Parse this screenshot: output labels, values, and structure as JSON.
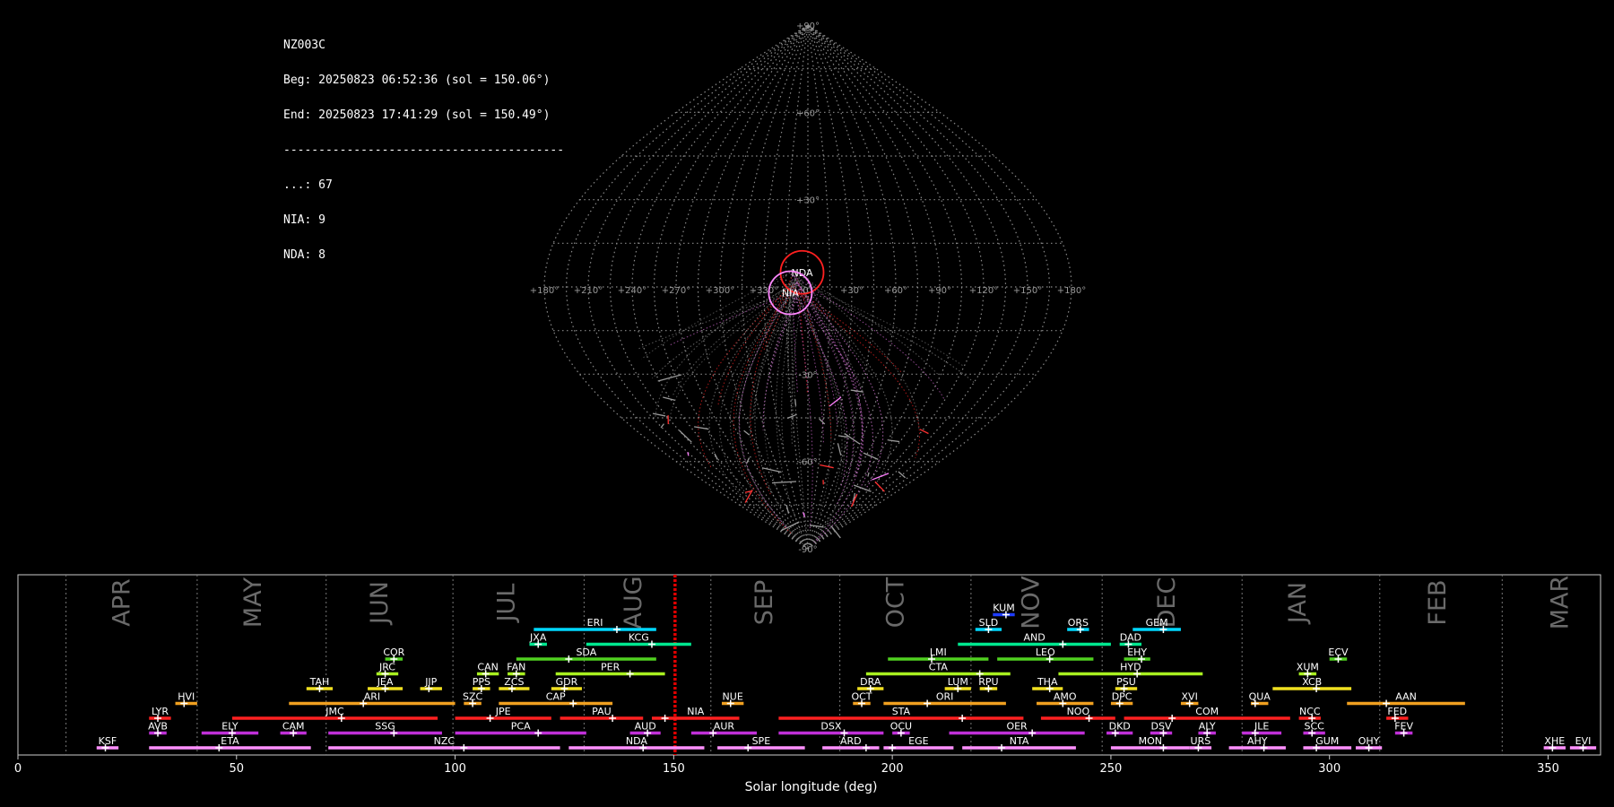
{
  "info": {
    "station": "NZ003C",
    "begin": "Beg: 20250823 06:52:36 (sol = 150.06°)",
    "end": "End: 20250823 17:41:29 (sol = 150.49°)",
    "separator": "----------------------------------------",
    "counts": [
      "...: 67",
      "NIA: 9",
      "NDA: 8"
    ]
  },
  "sky_map": {
    "projection": "sinusoidal",
    "lon_labels": [
      "+180°",
      "+150°",
      "+120°",
      "+90°",
      "+60°",
      "+30°",
      "0°",
      "+330°",
      "+300°",
      "+270°",
      "+240°",
      "+210°",
      "+180°"
    ],
    "lat_labels": [
      "+90°",
      "+60°",
      "+30°",
      "-30°",
      "-60°",
      "-90°"
    ],
    "radiants": [
      {
        "code": "NDA",
        "lon": -4,
        "lat": 5,
        "color": "#ff2020"
      },
      {
        "code": "NIA",
        "lon": -12,
        "lat": -2,
        "color": "#ff88ff"
      }
    ]
  },
  "chart_data": {
    "type": "bar",
    "xlabel": "Solar longitude (deg)",
    "xlim": [
      0,
      362
    ],
    "xticks": [
      0,
      50,
      100,
      150,
      200,
      250,
      300,
      350
    ],
    "current_sol": 150.3,
    "months": [
      {
        "name": "APR",
        "center": 24,
        "start": 11
      },
      {
        "name": "MAY",
        "center": 54,
        "start": 41
      },
      {
        "name": "JUN",
        "center": 83,
        "start": 70.5
      },
      {
        "name": "JUL",
        "center": 112,
        "start": 99.5
      },
      {
        "name": "AUG",
        "center": 141,
        "start": 129.5
      },
      {
        "name": "SEP",
        "center": 171,
        "start": 158.5
      },
      {
        "name": "OCT",
        "center": 201,
        "start": 188
      },
      {
        "name": "NOV",
        "center": 232,
        "start": 218
      },
      {
        "name": "DEC",
        "center": 263,
        "start": 248
      },
      {
        "name": "JAN",
        "center": 293,
        "start": 280
      },
      {
        "name": "FEB",
        "center": 325,
        "start": 311.5
      },
      {
        "name": "MAR",
        "center": 353,
        "start": 339.5
      }
    ],
    "showers": [
      {
        "code": "KUM",
        "start": 223,
        "end": 228,
        "peak": 226,
        "row": 9,
        "color": "#1e3cff"
      },
      {
        "code": "ERI",
        "start": 118,
        "end": 146,
        "peak": 137,
        "row": 8,
        "color": "#00d8ff"
      },
      {
        "code": "SLD",
        "start": 219,
        "end": 225,
        "peak": 222,
        "row": 8,
        "color": "#00d8ff"
      },
      {
        "code": "ORS",
        "start": 240,
        "end": 245,
        "peak": 243,
        "row": 8,
        "color": "#00d8ff"
      },
      {
        "code": "GEM",
        "start": 255,
        "end": 266,
        "peak": 262,
        "row": 8,
        "color": "#00d8ff"
      },
      {
        "code": "JXA",
        "start": 117,
        "end": 121,
        "peak": 119,
        "row": 7,
        "color": "#00e890"
      },
      {
        "code": "KCG",
        "start": 130,
        "end": 154,
        "peak": 145,
        "row": 7,
        "color": "#00e890"
      },
      {
        "code": "AND",
        "start": 215,
        "end": 250,
        "peak": 239,
        "row": 7,
        "color": "#00e890"
      },
      {
        "code": "DAD",
        "start": 252,
        "end": 257,
        "peak": 254,
        "row": 7,
        "color": "#00e890"
      },
      {
        "code": "COR",
        "start": 84,
        "end": 88,
        "peak": 86,
        "row": 6,
        "color": "#50d020"
      },
      {
        "code": "SDA",
        "start": 114,
        "end": 146,
        "peak": 126,
        "row": 6,
        "color": "#50d020"
      },
      {
        "code": "LMI",
        "start": 199,
        "end": 222,
        "peak": 209,
        "row": 6,
        "color": "#50d020"
      },
      {
        "code": "LEO",
        "start": 224,
        "end": 246,
        "peak": 236,
        "row": 6,
        "color": "#50d020"
      },
      {
        "code": "EHY",
        "start": 253,
        "end": 259,
        "peak": 257,
        "row": 6,
        "color": "#50d020"
      },
      {
        "code": "ECV",
        "start": 300,
        "end": 304,
        "peak": 302,
        "row": 6,
        "color": "#50d020"
      },
      {
        "code": "JRC",
        "start": 82,
        "end": 87,
        "peak": 84,
        "row": 5,
        "color": "#a8f020"
      },
      {
        "code": "CAN",
        "start": 105,
        "end": 110,
        "peak": 107,
        "row": 5,
        "color": "#a8f020"
      },
      {
        "code": "FAN",
        "start": 112,
        "end": 116,
        "peak": 114,
        "row": 5,
        "color": "#a8f020"
      },
      {
        "code": "PER",
        "start": 123,
        "end": 148,
        "peak": 140,
        "row": 5,
        "color": "#a8f020"
      },
      {
        "code": "CTA",
        "start": 194,
        "end": 227,
        "peak": 220,
        "row": 5,
        "color": "#a8f020"
      },
      {
        "code": "HYD",
        "start": 238,
        "end": 271,
        "peak": 256,
        "row": 5,
        "color": "#a8f020"
      },
      {
        "code": "XUM",
        "start": 293,
        "end": 297,
        "peak": 295,
        "row": 5,
        "color": "#a8f020"
      },
      {
        "code": "TAH",
        "start": 66,
        "end": 72,
        "peak": 69,
        "row": 4,
        "color": "#f0e020"
      },
      {
        "code": "JEA",
        "start": 80,
        "end": 88,
        "peak": 84,
        "row": 4,
        "color": "#f0e020"
      },
      {
        "code": "JIP",
        "start": 92,
        "end": 97,
        "peak": 94,
        "row": 4,
        "color": "#f0e020"
      },
      {
        "code": "PPS",
        "start": 104,
        "end": 108,
        "peak": 106,
        "row": 4,
        "color": "#f0e020"
      },
      {
        "code": "ZCS",
        "start": 110,
        "end": 117,
        "peak": 113,
        "row": 4,
        "color": "#f0e020"
      },
      {
        "code": "GDR",
        "start": 122,
        "end": 129,
        "peak": 125,
        "row": 4,
        "color": "#f0e020"
      },
      {
        "code": "DRA",
        "start": 192,
        "end": 198,
        "peak": 195,
        "row": 4,
        "color": "#f0e020"
      },
      {
        "code": "LUM",
        "start": 212,
        "end": 218,
        "peak": 215,
        "row": 4,
        "color": "#f0e020"
      },
      {
        "code": "RPU",
        "start": 220,
        "end": 224,
        "peak": 222,
        "row": 4,
        "color": "#f0e020"
      },
      {
        "code": "THA",
        "start": 232,
        "end": 239,
        "peak": 236,
        "row": 4,
        "color": "#f0e020"
      },
      {
        "code": "PSU",
        "start": 251,
        "end": 256,
        "peak": 253,
        "row": 4,
        "color": "#f0e020"
      },
      {
        "code": "XCB",
        "start": 287,
        "end": 305,
        "peak": 297,
        "row": 4,
        "color": "#f0e020"
      },
      {
        "code": "HVI",
        "start": 36,
        "end": 41,
        "peak": 38,
        "row": 3,
        "color": "#f0a020"
      },
      {
        "code": "ARI",
        "start": 62,
        "end": 100,
        "peak": 79,
        "row": 3,
        "color": "#f0a020"
      },
      {
        "code": "SZC",
        "start": 102,
        "end": 106,
        "peak": 104,
        "row": 3,
        "color": "#f0a020"
      },
      {
        "code": "CAP",
        "start": 110,
        "end": 136,
        "peak": 127,
        "row": 3,
        "color": "#f0a020"
      },
      {
        "code": "NUE",
        "start": 161,
        "end": 166,
        "peak": 163,
        "row": 3,
        "color": "#f0a020"
      },
      {
        "code": "OCT",
        "start": 191,
        "end": 195,
        "peak": 193,
        "row": 3,
        "color": "#f0a020"
      },
      {
        "code": "ORI",
        "start": 198,
        "end": 226,
        "peak": 208,
        "row": 3,
        "color": "#f0a020"
      },
      {
        "code": "AMO",
        "start": 233,
        "end": 246,
        "peak": 239,
        "row": 3,
        "color": "#f0a020"
      },
      {
        "code": "DPC",
        "start": 250,
        "end": 255,
        "peak": 252,
        "row": 3,
        "color": "#f0a020"
      },
      {
        "code": "XVI",
        "start": 266,
        "end": 270,
        "peak": 268,
        "row": 3,
        "color": "#f0a020"
      },
      {
        "code": "QUA",
        "start": 282,
        "end": 286,
        "peak": 283,
        "row": 3,
        "color": "#f0a020"
      },
      {
        "code": "AAN",
        "start": 304,
        "end": 331,
        "peak": 313,
        "row": 3,
        "color": "#f0a020"
      },
      {
        "code": "LYR",
        "start": 30,
        "end": 35,
        "peak": 32,
        "row": 2,
        "color": "#ff2020"
      },
      {
        "code": "JMC",
        "start": 49,
        "end": 96,
        "peak": 74,
        "row": 2,
        "color": "#ff2020"
      },
      {
        "code": "JPE",
        "start": 100,
        "end": 122,
        "peak": 108,
        "row": 2,
        "color": "#ff2020"
      },
      {
        "code": "PAU",
        "start": 124,
        "end": 143,
        "peak": 136,
        "row": 2,
        "color": "#ff2020"
      },
      {
        "code": "NIA",
        "start": 145,
        "end": 165,
        "peak": 148,
        "row": 2,
        "color": "#ff2020"
      },
      {
        "code": "STA",
        "start": 174,
        "end": 230,
        "peak": 216,
        "row": 2,
        "color": "#ff2020"
      },
      {
        "code": "NOO",
        "start": 234,
        "end": 251,
        "peak": 245,
        "row": 2,
        "color": "#ff2020"
      },
      {
        "code": "COM",
        "start": 253,
        "end": 291,
        "peak": 264,
        "row": 2,
        "color": "#ff2020"
      },
      {
        "code": "NCC",
        "start": 293,
        "end": 298,
        "peak": 296,
        "row": 2,
        "color": "#ff2020"
      },
      {
        "code": "FED",
        "start": 313,
        "end": 318,
        "peak": 315,
        "row": 2,
        "color": "#ff2020"
      },
      {
        "code": "AVB",
        "start": 30,
        "end": 34,
        "peak": 32,
        "row": 1,
        "color": "#c030d8"
      },
      {
        "code": "ELY",
        "start": 42,
        "end": 55,
        "peak": 49,
        "row": 1,
        "color": "#c030d8"
      },
      {
        "code": "CAM",
        "start": 60,
        "end": 66,
        "peak": 63,
        "row": 1,
        "color": "#c030d8"
      },
      {
        "code": "SSG",
        "start": 71,
        "end": 97,
        "peak": 86,
        "row": 1,
        "color": "#c030d8"
      },
      {
        "code": "PCA",
        "start": 100,
        "end": 130,
        "peak": 119,
        "row": 1,
        "color": "#c030d8"
      },
      {
        "code": "AUD",
        "start": 140,
        "end": 147,
        "peak": 144,
        "row": 1,
        "color": "#c030d8"
      },
      {
        "code": "AUR",
        "start": 154,
        "end": 169,
        "peak": 159,
        "row": 1,
        "color": "#c030d8"
      },
      {
        "code": "DSX",
        "start": 174,
        "end": 198,
        "peak": 189,
        "row": 1,
        "color": "#c030d8"
      },
      {
        "code": "OCU",
        "start": 200,
        "end": 204,
        "peak": 202,
        "row": 1,
        "color": "#c030d8"
      },
      {
        "code": "OER",
        "start": 213,
        "end": 244,
        "peak": 232,
        "row": 1,
        "color": "#c030d8"
      },
      {
        "code": "DKD",
        "start": 249,
        "end": 255,
        "peak": 251,
        "row": 1,
        "color": "#c030d8"
      },
      {
        "code": "DSV",
        "start": 259,
        "end": 264,
        "peak": 262,
        "row": 1,
        "color": "#c030d8"
      },
      {
        "code": "ALY",
        "start": 270,
        "end": 274,
        "peak": 272,
        "row": 1,
        "color": "#c030d8"
      },
      {
        "code": "JLE",
        "start": 280,
        "end": 289,
        "peak": 283,
        "row": 1,
        "color": "#c030d8"
      },
      {
        "code": "SCC",
        "start": 294,
        "end": 299,
        "peak": 296,
        "row": 1,
        "color": "#c030d8"
      },
      {
        "code": "FEV",
        "start": 315,
        "end": 319,
        "peak": 317,
        "row": 1,
        "color": "#c030d8"
      },
      {
        "code": "KSF",
        "start": 18,
        "end": 23,
        "peak": 20,
        "row": 0,
        "color": "#ff90ff"
      },
      {
        "code": "ETA",
        "start": 30,
        "end": 67,
        "peak": 46,
        "row": 0,
        "color": "#ff90ff"
      },
      {
        "code": "NZC",
        "start": 71,
        "end": 124,
        "peak": 102,
        "row": 0,
        "color": "#ff90ff"
      },
      {
        "code": "NDA",
        "start": 126,
        "end": 157,
        "peak": 143,
        "row": 0,
        "color": "#ff90ff"
      },
      {
        "code": "SPE",
        "start": 160,
        "end": 180,
        "peak": 167,
        "row": 0,
        "color": "#ff90ff"
      },
      {
        "code": "ARD",
        "start": 184,
        "end": 197,
        "peak": 194,
        "row": 0,
        "color": "#ff90ff"
      },
      {
        "code": "EGE",
        "start": 198,
        "end": 214,
        "peak": 200,
        "row": 0,
        "color": "#ff90ff"
      },
      {
        "code": "NTA",
        "start": 216,
        "end": 242,
        "peak": 225,
        "row": 0,
        "color": "#ff90ff"
      },
      {
        "code": "MON",
        "start": 250,
        "end": 268,
        "peak": 262,
        "row": 0,
        "color": "#ff90ff"
      },
      {
        "code": "URS",
        "start": 268,
        "end": 273,
        "peak": 270,
        "row": 0,
        "color": "#ff90ff"
      },
      {
        "code": "AHY",
        "start": 277,
        "end": 290,
        "peak": 285,
        "row": 0,
        "color": "#ff90ff"
      },
      {
        "code": "GUM",
        "start": 294,
        "end": 305,
        "peak": 297,
        "row": 0,
        "color": "#ff90ff"
      },
      {
        "code": "OHY",
        "start": 306,
        "end": 312,
        "peak": 309,
        "row": 0,
        "color": "#ff90ff"
      },
      {
        "code": "XHE",
        "start": 349,
        "end": 354,
        "peak": 351,
        "row": 0,
        "color": "#ff90ff"
      },
      {
        "code": "EVI",
        "start": 355,
        "end": 361,
        "peak": 358,
        "row": 0,
        "color": "#ff90ff"
      }
    ]
  }
}
